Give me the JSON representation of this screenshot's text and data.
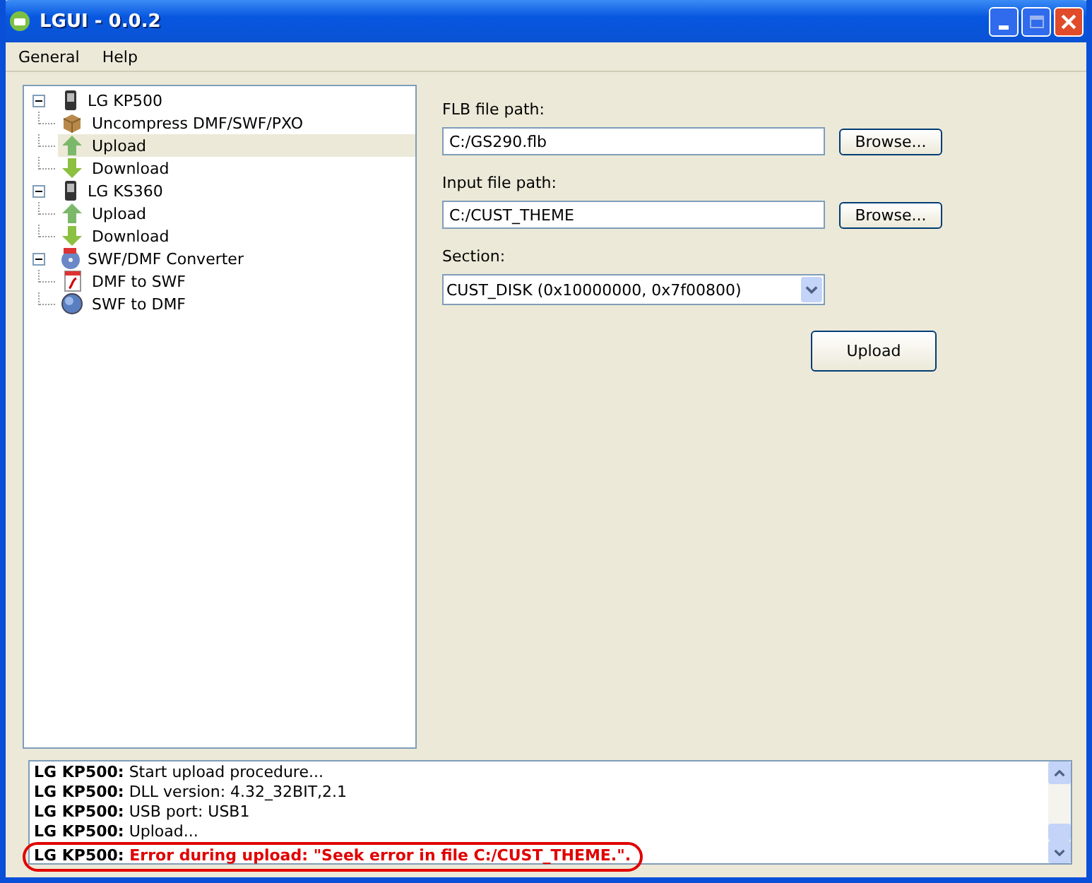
{
  "window": {
    "title": "LGUI - 0.0.2"
  },
  "menu": [
    "General",
    "Help"
  ],
  "tree": [
    {
      "label": "LG KP500",
      "kind": "phone",
      "expanded": true,
      "selected": false,
      "children": [
        {
          "label": "Uncompress DMF/SWF/PXO",
          "kind": "box",
          "selected": false
        },
        {
          "label": "Upload",
          "kind": "upload",
          "selected": true
        },
        {
          "label": "Download",
          "kind": "download",
          "selected": false
        }
      ]
    },
    {
      "label": "LG KS360",
      "kind": "phone",
      "expanded": true,
      "selected": false,
      "children": [
        {
          "label": "Upload",
          "kind": "upload",
          "selected": false
        },
        {
          "label": "Download",
          "kind": "download",
          "selected": false
        }
      ]
    },
    {
      "label": "SWF/DMF Converter",
      "kind": "converter",
      "expanded": true,
      "selected": false,
      "children": [
        {
          "label": "DMF to SWF",
          "kind": "flash",
          "selected": false
        },
        {
          "label": "SWF to DMF",
          "kind": "globe",
          "selected": false
        }
      ]
    }
  ],
  "form": {
    "flb_label": "FLB file path:",
    "flb_value": "C:/GS290.flb",
    "input_label": "Input file path:",
    "input_value": "C:/CUST_THEME",
    "browse_flb": "Browse...",
    "browse_input": "Browse...",
    "section_label": "Section:",
    "section_value": "CUST_DISK (0x10000000, 0x7f00800)",
    "upload": "Upload"
  },
  "log": [
    {
      "source": "LG KP500:",
      "message": "Start upload procedure...",
      "kind": "info"
    },
    {
      "source": "LG KP500:",
      "message": "DLL version: 4.32_32BIT,2.1",
      "kind": "info"
    },
    {
      "source": "LG KP500:",
      "message": "USB port: USB1",
      "kind": "info"
    },
    {
      "source": "LG KP500:",
      "message": "Upload...",
      "kind": "info"
    },
    {
      "source": "LG KP500:",
      "message": "Error during upload: \"Seek error in file C:/CUST_THEME.\".",
      "kind": "error"
    }
  ]
}
